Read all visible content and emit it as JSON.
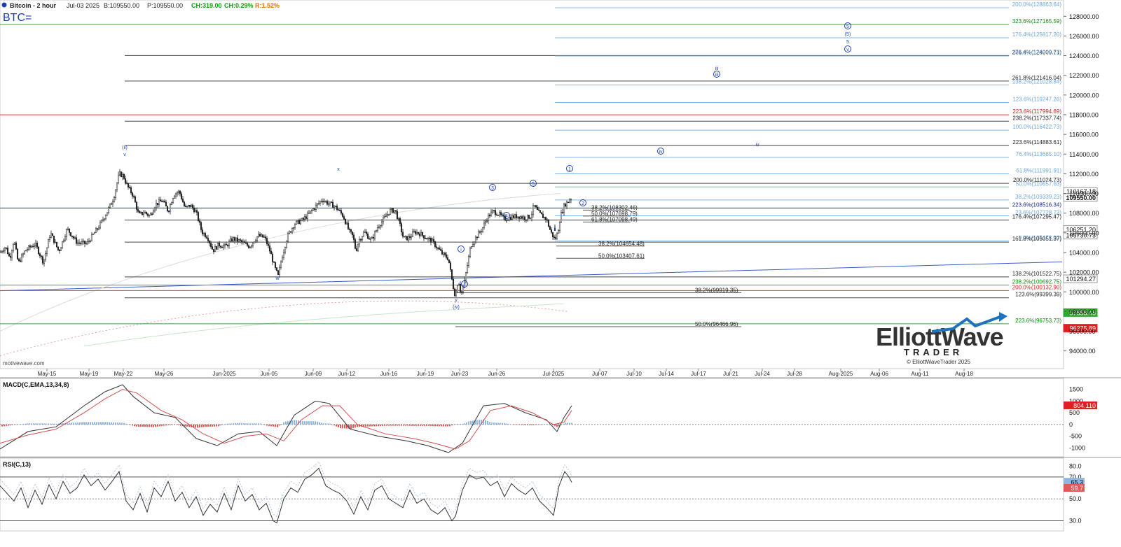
{
  "header": {
    "symbol_name": "Bitcoin - 2 hour",
    "date": "Jul-03 2025",
    "bid": "B:109550.00",
    "last": "P:109550.00",
    "change": "CH:319.00",
    "change_pct": "CH:0.29%",
    "range": "R:1.52%",
    "ticker": "BTC="
  },
  "watermark": "motivewave.com",
  "brand": {
    "line1": "ElliottWave",
    "line2": "TRADER",
    "copyright": "© ElliottWaveTrader 2025",
    "accent": "#1e73be"
  },
  "colors": {
    "up_green": "#0a9a0a",
    "down_red": "#cc0000",
    "wave_blue": "#1a3fb0",
    "fib_light": "#7fb4e6",
    "fib_dark": "#333333",
    "ma_pink": "#e0a0a0"
  },
  "chart_data": [
    {
      "type": "candlestick",
      "title": "Bitcoin - 2 hour",
      "x_labels": [
        "May-15",
        "May-19",
        "May-22",
        "May-26",
        "Jun-2025",
        "Jun-05",
        "Jun-09",
        "Jun-12",
        "Jun-16",
        "Jun-19",
        "Jun-23",
        "Jun-26",
        "Jul-2025",
        "Jul-07",
        "Jul-10",
        "Jul-14",
        "Jul-17",
        "Jul-21",
        "Jul-24",
        "Jul-28",
        "Aug-2025",
        "Aug-06",
        "Aug-11",
        "Aug-18"
      ],
      "y_ticks": [
        94000,
        96000,
        98000,
        100000,
        102000,
        104000,
        106000,
        108000,
        110000,
        112000,
        114000,
        116000,
        118000,
        120000,
        122000,
        124000,
        126000,
        128000
      ],
      "ylim": [
        92200,
        129300
      ],
      "price_path": [
        [
          0,
          104000
        ],
        [
          8,
          104600
        ],
        [
          14,
          103400
        ],
        [
          20,
          105300
        ],
        [
          26,
          102900
        ],
        [
          36,
          104200
        ],
        [
          50,
          104900
        ],
        [
          62,
          103000
        ],
        [
          72,
          106000
        ],
        [
          84,
          104100
        ],
        [
          96,
          106400
        ],
        [
          110,
          105000
        ],
        [
          124,
          104900
        ],
        [
          140,
          106500
        ],
        [
          152,
          108000
        ],
        [
          162,
          109500
        ],
        [
          170,
          112000
        ],
        [
          176,
          111800
        ],
        [
          182,
          110700
        ],
        [
          190,
          109800
        ],
        [
          198,
          107800
        ],
        [
          206,
          108100
        ],
        [
          214,
          107700
        ],
        [
          222,
          108900
        ],
        [
          232,
          109300
        ],
        [
          240,
          108200
        ],
        [
          248,
          109900
        ],
        [
          256,
          110200
        ],
        [
          264,
          108500
        ],
        [
          272,
          108800
        ],
        [
          280,
          108100
        ],
        [
          288,
          106100
        ],
        [
          296,
          105600
        ],
        [
          304,
          104200
        ],
        [
          312,
          104800
        ],
        [
          322,
          104600
        ],
        [
          332,
          105400
        ],
        [
          344,
          105100
        ],
        [
          356,
          104600
        ],
        [
          368,
          105700
        ],
        [
          378,
          105500
        ],
        [
          386,
          104000
        ],
        [
          392,
          102500
        ],
        [
          397,
          101600
        ],
        [
          402,
          103400
        ],
        [
          410,
          105600
        ],
        [
          420,
          106900
        ],
        [
          432,
          107300
        ],
        [
          442,
          108000
        ],
        [
          452,
          108800
        ],
        [
          460,
          109400
        ],
        [
          468,
          109000
        ],
        [
          476,
          108800
        ],
        [
          482,
          108400
        ],
        [
          490,
          107700
        ],
        [
          498,
          106200
        ],
        [
          504,
          105600
        ],
        [
          508,
          104100
        ],
        [
          512,
          105200
        ],
        [
          520,
          106100
        ],
        [
          530,
          105200
        ],
        [
          540,
          106700
        ],
        [
          548,
          107400
        ],
        [
          556,
          108200
        ],
        [
          564,
          108300
        ],
        [
          570,
          107000
        ],
        [
          576,
          105400
        ],
        [
          584,
          105500
        ],
        [
          592,
          106100
        ],
        [
          600,
          105900
        ],
        [
          608,
          105500
        ],
        [
          616,
          105200
        ],
        [
          624,
          104500
        ],
        [
          632,
          103800
        ],
        [
          640,
          103400
        ],
        [
          646,
          100800
        ],
        [
          650,
          99500
        ],
        [
          654,
          101300
        ],
        [
          658,
          99800
        ],
        [
          662,
          100600
        ],
        [
          666,
          102300
        ],
        [
          672,
          104700
        ],
        [
          680,
          105600
        ],
        [
          688,
          106400
        ],
        [
          696,
          107600
        ],
        [
          704,
          108200
        ],
        [
          712,
          107900
        ],
        [
          720,
          107400
        ],
        [
          730,
          107600
        ],
        [
          740,
          107700
        ],
        [
          750,
          107500
        ],
        [
          758,
          107700
        ],
        [
          762,
          108800
        ],
        [
          768,
          108100
        ],
        [
          774,
          107700
        ],
        [
          780,
          107400
        ],
        [
          786,
          106100
        ],
        [
          792,
          105300
        ],
        [
          796,
          106000
        ],
        [
          800,
          107700
        ],
        [
          806,
          108900
        ],
        [
          810,
          109100
        ],
        [
          814,
          109500
        ],
        [
          816,
          109550
        ]
      ],
      "fib_levels": [
        {
          "label": "200.0%(128863.64)",
          "value": 128863.64,
          "color": "light"
        },
        {
          "label": "323.6%(127165.59)",
          "value": 127165.59,
          "color": "green"
        },
        {
          "label": "176.4%(125817.20)",
          "value": 125817.2,
          "color": "light"
        },
        {
          "label": "276.4%(124009.71)",
          "value": 124009.71,
          "color": "dark"
        },
        {
          "label": "161.8%(123965.13)",
          "value": 123965.13,
          "color": "light"
        },
        {
          "label": "261.8%(121416.04)",
          "value": 121416.04,
          "color": "dark"
        },
        {
          "label": "138.2%(121028.84)",
          "value": 121028.84,
          "color": "light"
        },
        {
          "label": "123.6%(119247.26)",
          "value": 119247.26,
          "color": "light"
        },
        {
          "label": "223.6%(117994.69)",
          "value": 117994.69,
          "color": "red"
        },
        {
          "label": "238.2%(117337.74)",
          "value": 117337.74,
          "color": "dark"
        },
        {
          "label": "100.0%(116422.73)",
          "value": 116422.73,
          "color": "light"
        },
        {
          "label": "223.6%(114883.61)",
          "value": 114883.61,
          "color": "dark"
        },
        {
          "label": "76.4%(113665.10)",
          "value": 113665.1,
          "color": "light"
        },
        {
          "label": "61.8%(111991.91)",
          "value": 111991.91,
          "color": "light"
        },
        {
          "label": "200.0%(111024.73)",
          "value": 111024.73,
          "color": "dark"
        },
        {
          "label": "50.0%(110657.63)",
          "value": 110657.63,
          "color": "light"
        },
        {
          "label": "38.2%(109339.23)",
          "value": 109339.23,
          "color": "light"
        },
        {
          "label": "223.6%(108516.34)",
          "value": 108516.34,
          "color": "navy"
        },
        {
          "label": "23.6%(107728.73)",
          "value": 107728.73,
          "color": "light"
        },
        {
          "label": "176.4%(107295.47)",
          "value": 107295.47,
          "color": "dark"
        },
        {
          "label": "0.0%(105178.00)",
          "value": 105178.0,
          "color": "light"
        },
        {
          "label": "161.8%(105051.37)",
          "value": 105051.37,
          "color": "dark"
        },
        {
          "label": "138.2%(101522.75)",
          "value": 101522.75,
          "color": "dark"
        },
        {
          "label": "238.2%(100692.75)",
          "value": 100692.75,
          "color": "green"
        },
        {
          "label": "200.0%(100132.90)",
          "value": 100132.9,
          "color": "red"
        },
        {
          "label": "123.6%(99399.39)",
          "value": 99399.39,
          "color": "dark"
        },
        {
          "label": "223.6%(96753.73)",
          "value": 96753.73,
          "color": "green"
        }
      ],
      "retracements": [
        {
          "label": "38.2%(108302.46)",
          "value": 108302.46
        },
        {
          "label": "50.0%(107698.79)",
          "value": 107698.79
        },
        {
          "label": "61.8%(107098.49)",
          "value": 107098.49
        },
        {
          "label": "38.2%(104654.48)",
          "value": 104654.48
        },
        {
          "label": "50.0%(103407.61)",
          "value": 103407.61
        },
        {
          "label": "38.2%(99919.35)",
          "value": 99919.35
        },
        {
          "label": "50.0%(96466.96)",
          "value": 96466.96
        }
      ],
      "price_tags": [
        {
          "text": "110167.18",
          "value": 110167.18,
          "style": "plain"
        },
        {
          "text": "109550.00",
          "value": 109550.0,
          "style": "bold"
        },
        {
          "text": "106251.20",
          "value": 106300.0,
          "style": "plain"
        },
        {
          "text": "105730.73",
          "value": 105730.73,
          "style": "plain"
        },
        {
          "text": "101294.27",
          "value": 101294.27,
          "style": "plain"
        },
        {
          "text": "97858.48",
          "value": 97858.48,
          "style": "green"
        },
        {
          "text": "96275.89",
          "value": 96275.89,
          "style": "red"
        }
      ],
      "wave_labels": [
        "(ii)",
        "v",
        "w",
        "x",
        "y",
        "(iv)",
        "1",
        "2",
        "3",
        "4",
        "5",
        "i",
        "ii",
        "iii",
        "iv",
        "v",
        "(5)",
        "5",
        "iii",
        "iv",
        "5"
      ]
    },
    {
      "type": "line",
      "title": "MACD(C,EMA,13,34,8)",
      "y_ticks": [
        1500,
        1000,
        500,
        0,
        -500,
        -1000
      ],
      "ylim": [
        -1350,
        1850
      ],
      "last_value_tag": "804.110",
      "macd": [
        [
          0,
          -1050
        ],
        [
          40,
          -300
        ],
        [
          80,
          -100
        ],
        [
          120,
          800
        ],
        [
          150,
          1400
        ],
        [
          175,
          1700
        ],
        [
          190,
          1200
        ],
        [
          220,
          500
        ],
        [
          250,
          300
        ],
        [
          280,
          -600
        ],
        [
          310,
          -900
        ],
        [
          340,
          -400
        ],
        [
          370,
          -300
        ],
        [
          395,
          -900
        ],
        [
          420,
          400
        ],
        [
          450,
          1000
        ],
        [
          470,
          900
        ],
        [
          500,
          -200
        ],
        [
          540,
          -500
        ],
        [
          580,
          -700
        ],
        [
          610,
          -900
        ],
        [
          640,
          -1200
        ],
        [
          660,
          -800
        ],
        [
          690,
          800
        ],
        [
          720,
          900
        ],
        [
          750,
          500
        ],
        [
          780,
          200
        ],
        [
          795,
          -300
        ],
        [
          805,
          300
        ],
        [
          816,
          800
        ]
      ],
      "signal": [
        [
          0,
          -800
        ],
        [
          40,
          -450
        ],
        [
          80,
          -200
        ],
        [
          120,
          500
        ],
        [
          150,
          1100
        ],
        [
          175,
          1500
        ],
        [
          195,
          1350
        ],
        [
          230,
          600
        ],
        [
          260,
          200
        ],
        [
          290,
          -400
        ],
        [
          320,
          -800
        ],
        [
          350,
          -500
        ],
        [
          380,
          -400
        ],
        [
          405,
          -700
        ],
        [
          430,
          200
        ],
        [
          460,
          800
        ],
        [
          485,
          800
        ],
        [
          510,
          0
        ],
        [
          550,
          -400
        ],
        [
          590,
          -600
        ],
        [
          620,
          -800
        ],
        [
          650,
          -1050
        ],
        [
          670,
          -700
        ],
        [
          700,
          600
        ],
        [
          730,
          800
        ],
        [
          760,
          500
        ],
        [
          790,
          0
        ],
        [
          805,
          100
        ],
        [
          816,
          600
        ]
      ]
    },
    {
      "type": "line",
      "title": "RSI(C,13)",
      "y_ticks": [
        80.0,
        70.0,
        50.0,
        30.0
      ],
      "ylim": [
        22,
        84
      ],
      "last_value_tags": [
        "65.3",
        "59.7"
      ],
      "rsi": [
        [
          0,
          62
        ],
        [
          10,
          55
        ],
        [
          20,
          48
        ],
        [
          30,
          60
        ],
        [
          40,
          42
        ],
        [
          50,
          58
        ],
        [
          60,
          45
        ],
        [
          70,
          63
        ],
        [
          80,
          50
        ],
        [
          90,
          66
        ],
        [
          100,
          55
        ],
        [
          110,
          60
        ],
        [
          120,
          72
        ],
        [
          130,
          62
        ],
        [
          140,
          68
        ],
        [
          150,
          58
        ],
        [
          160,
          66
        ],
        [
          170,
          75
        ],
        [
          180,
          48
        ],
        [
          190,
          40
        ],
        [
          200,
          55
        ],
        [
          210,
          38
        ],
        [
          220,
          60
        ],
        [
          230,
          52
        ],
        [
          240,
          66
        ],
        [
          250,
          48
        ],
        [
          260,
          56
        ],
        [
          270,
          42
        ],
        [
          280,
          52
        ],
        [
          290,
          35
        ],
        [
          300,
          45
        ],
        [
          310,
          38
        ],
        [
          320,
          55
        ],
        [
          330,
          40
        ],
        [
          340,
          62
        ],
        [
          350,
          48
        ],
        [
          360,
          54
        ],
        [
          370,
          40
        ],
        [
          380,
          46
        ],
        [
          390,
          30
        ],
        [
          395,
          28
        ],
        [
          405,
          50
        ],
        [
          415,
          60
        ],
        [
          425,
          56
        ],
        [
          435,
          68
        ],
        [
          445,
          72
        ],
        [
          455,
          78
        ],
        [
          465,
          62
        ],
        [
          475,
          58
        ],
        [
          485,
          55
        ],
        [
          495,
          48
        ],
        [
          505,
          36
        ],
        [
          515,
          52
        ],
        [
          525,
          40
        ],
        [
          535,
          58
        ],
        [
          545,
          62
        ],
        [
          555,
          50
        ],
        [
          565,
          46
        ],
        [
          575,
          42
        ],
        [
          585,
          58
        ],
        [
          595,
          46
        ],
        [
          605,
          50
        ],
        [
          615,
          40
        ],
        [
          625,
          36
        ],
        [
          635,
          42
        ],
        [
          645,
          30
        ],
        [
          650,
          34
        ],
        [
          660,
          58
        ],
        [
          670,
          72
        ],
        [
          680,
          68
        ],
        [
          690,
          70
        ],
        [
          700,
          62
        ],
        [
          710,
          66
        ],
        [
          720,
          52
        ],
        [
          730,
          64
        ],
        [
          740,
          58
        ],
        [
          750,
          54
        ],
        [
          760,
          60
        ],
        [
          770,
          48
        ],
        [
          780,
          42
        ],
        [
          790,
          35
        ],
        [
          798,
          62
        ],
        [
          806,
          75
        ],
        [
          812,
          70
        ],
        [
          816,
          65
        ]
      ]
    }
  ]
}
